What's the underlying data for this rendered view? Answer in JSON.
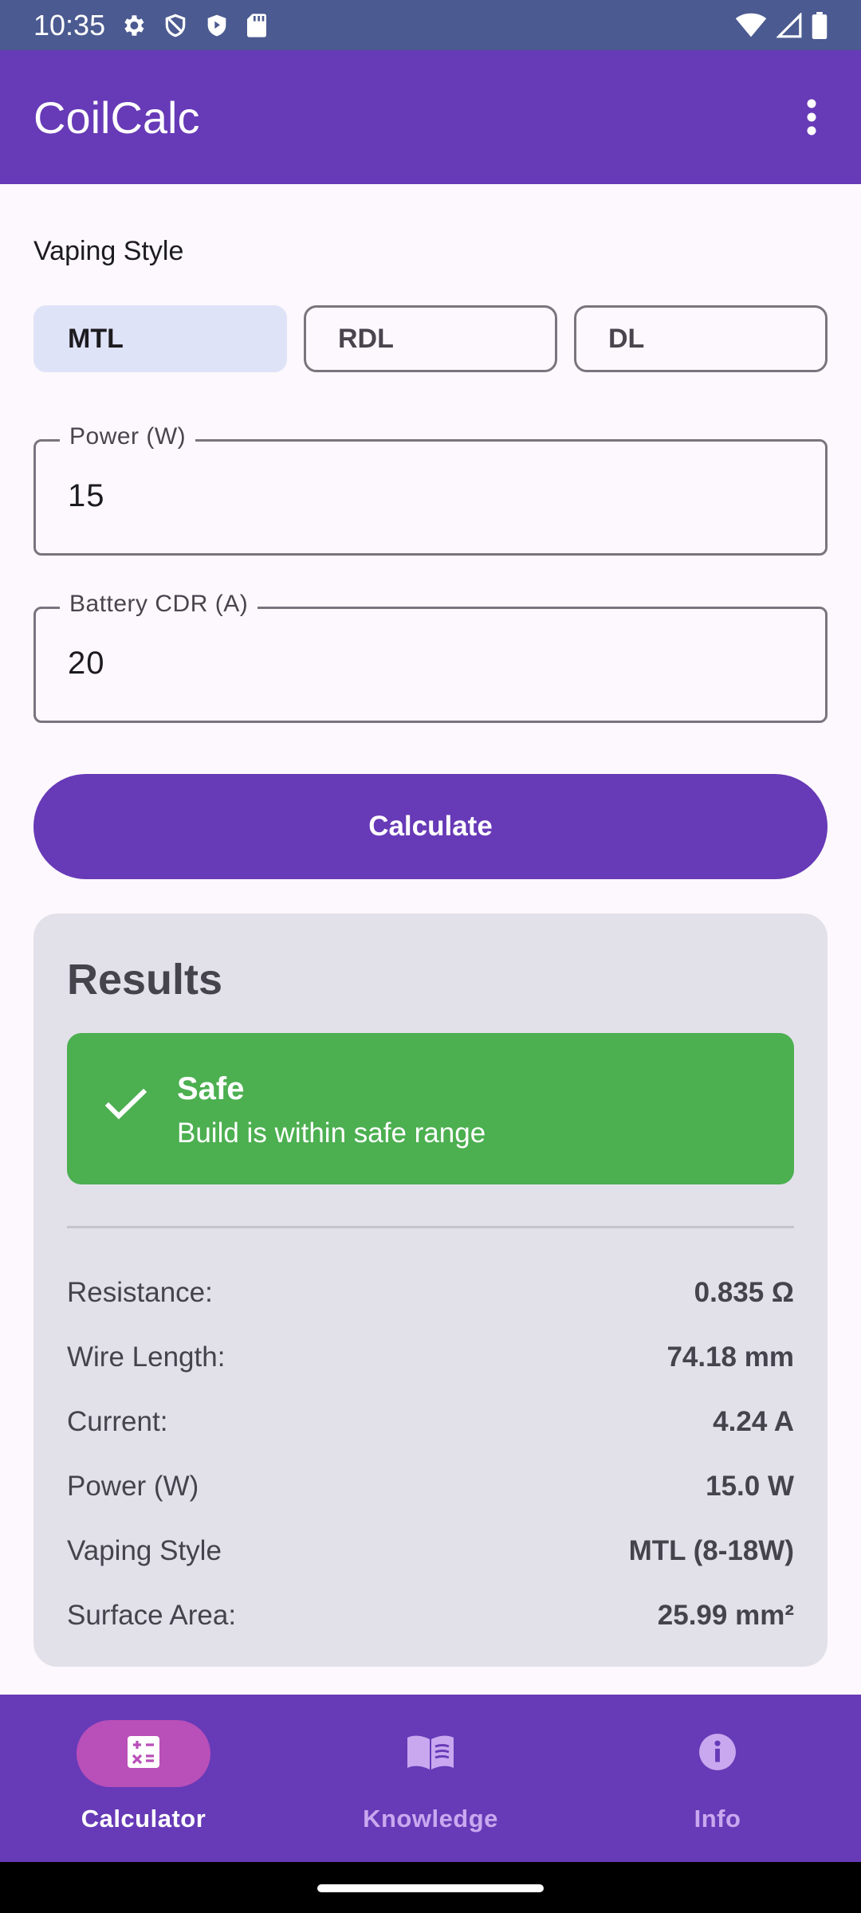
{
  "status_bar": {
    "time": "10:35",
    "icons": [
      "settings-icon",
      "shield-icon",
      "play-shield-icon",
      "sd-card-icon",
      "wifi-icon",
      "signal-icon",
      "battery-icon"
    ]
  },
  "app_bar": {
    "title": "CoilCalc",
    "menu_icon": "more-vert-icon"
  },
  "vaping_style": {
    "label": "Vaping Style",
    "options": [
      "MTL",
      "RDL",
      "DL"
    ],
    "selected": "MTL"
  },
  "power_field": {
    "label": "Power (W)",
    "value": "15"
  },
  "cdr_field": {
    "label": "Battery CDR (A)",
    "value": "20"
  },
  "calculate_button": {
    "label": "Calculate"
  },
  "results": {
    "title": "Results",
    "status": {
      "title": "Safe",
      "subtitle": "Build is within safe range",
      "icon": "check-icon",
      "color": "#4caf50"
    },
    "rows": [
      {
        "label": "Resistance:",
        "value": "0.835 Ω"
      },
      {
        "label": "Wire Length:",
        "value": "74.18 mm"
      },
      {
        "label": "Current:",
        "value": "4.24 A"
      },
      {
        "label": "Power (W)",
        "value": "15.0 W"
      },
      {
        "label": "Vaping Style",
        "value": "MTL (8-18W)"
      },
      {
        "label": "Surface Area:",
        "value": "25.99 mm²"
      }
    ]
  },
  "bottom_nav": {
    "items": [
      {
        "label": "Calculator",
        "icon": "calculator-icon",
        "active": true
      },
      {
        "label": "Knowledge",
        "icon": "book-icon",
        "active": false
      },
      {
        "label": "Info",
        "icon": "info-icon",
        "active": false
      }
    ]
  },
  "colors": {
    "primary": "#673ab7",
    "status_bar": "#4b5a90",
    "selected_chip": "#dfe3f7",
    "results_card": "#e2e1ea",
    "nav_active_pill": "#b94fb9"
  }
}
